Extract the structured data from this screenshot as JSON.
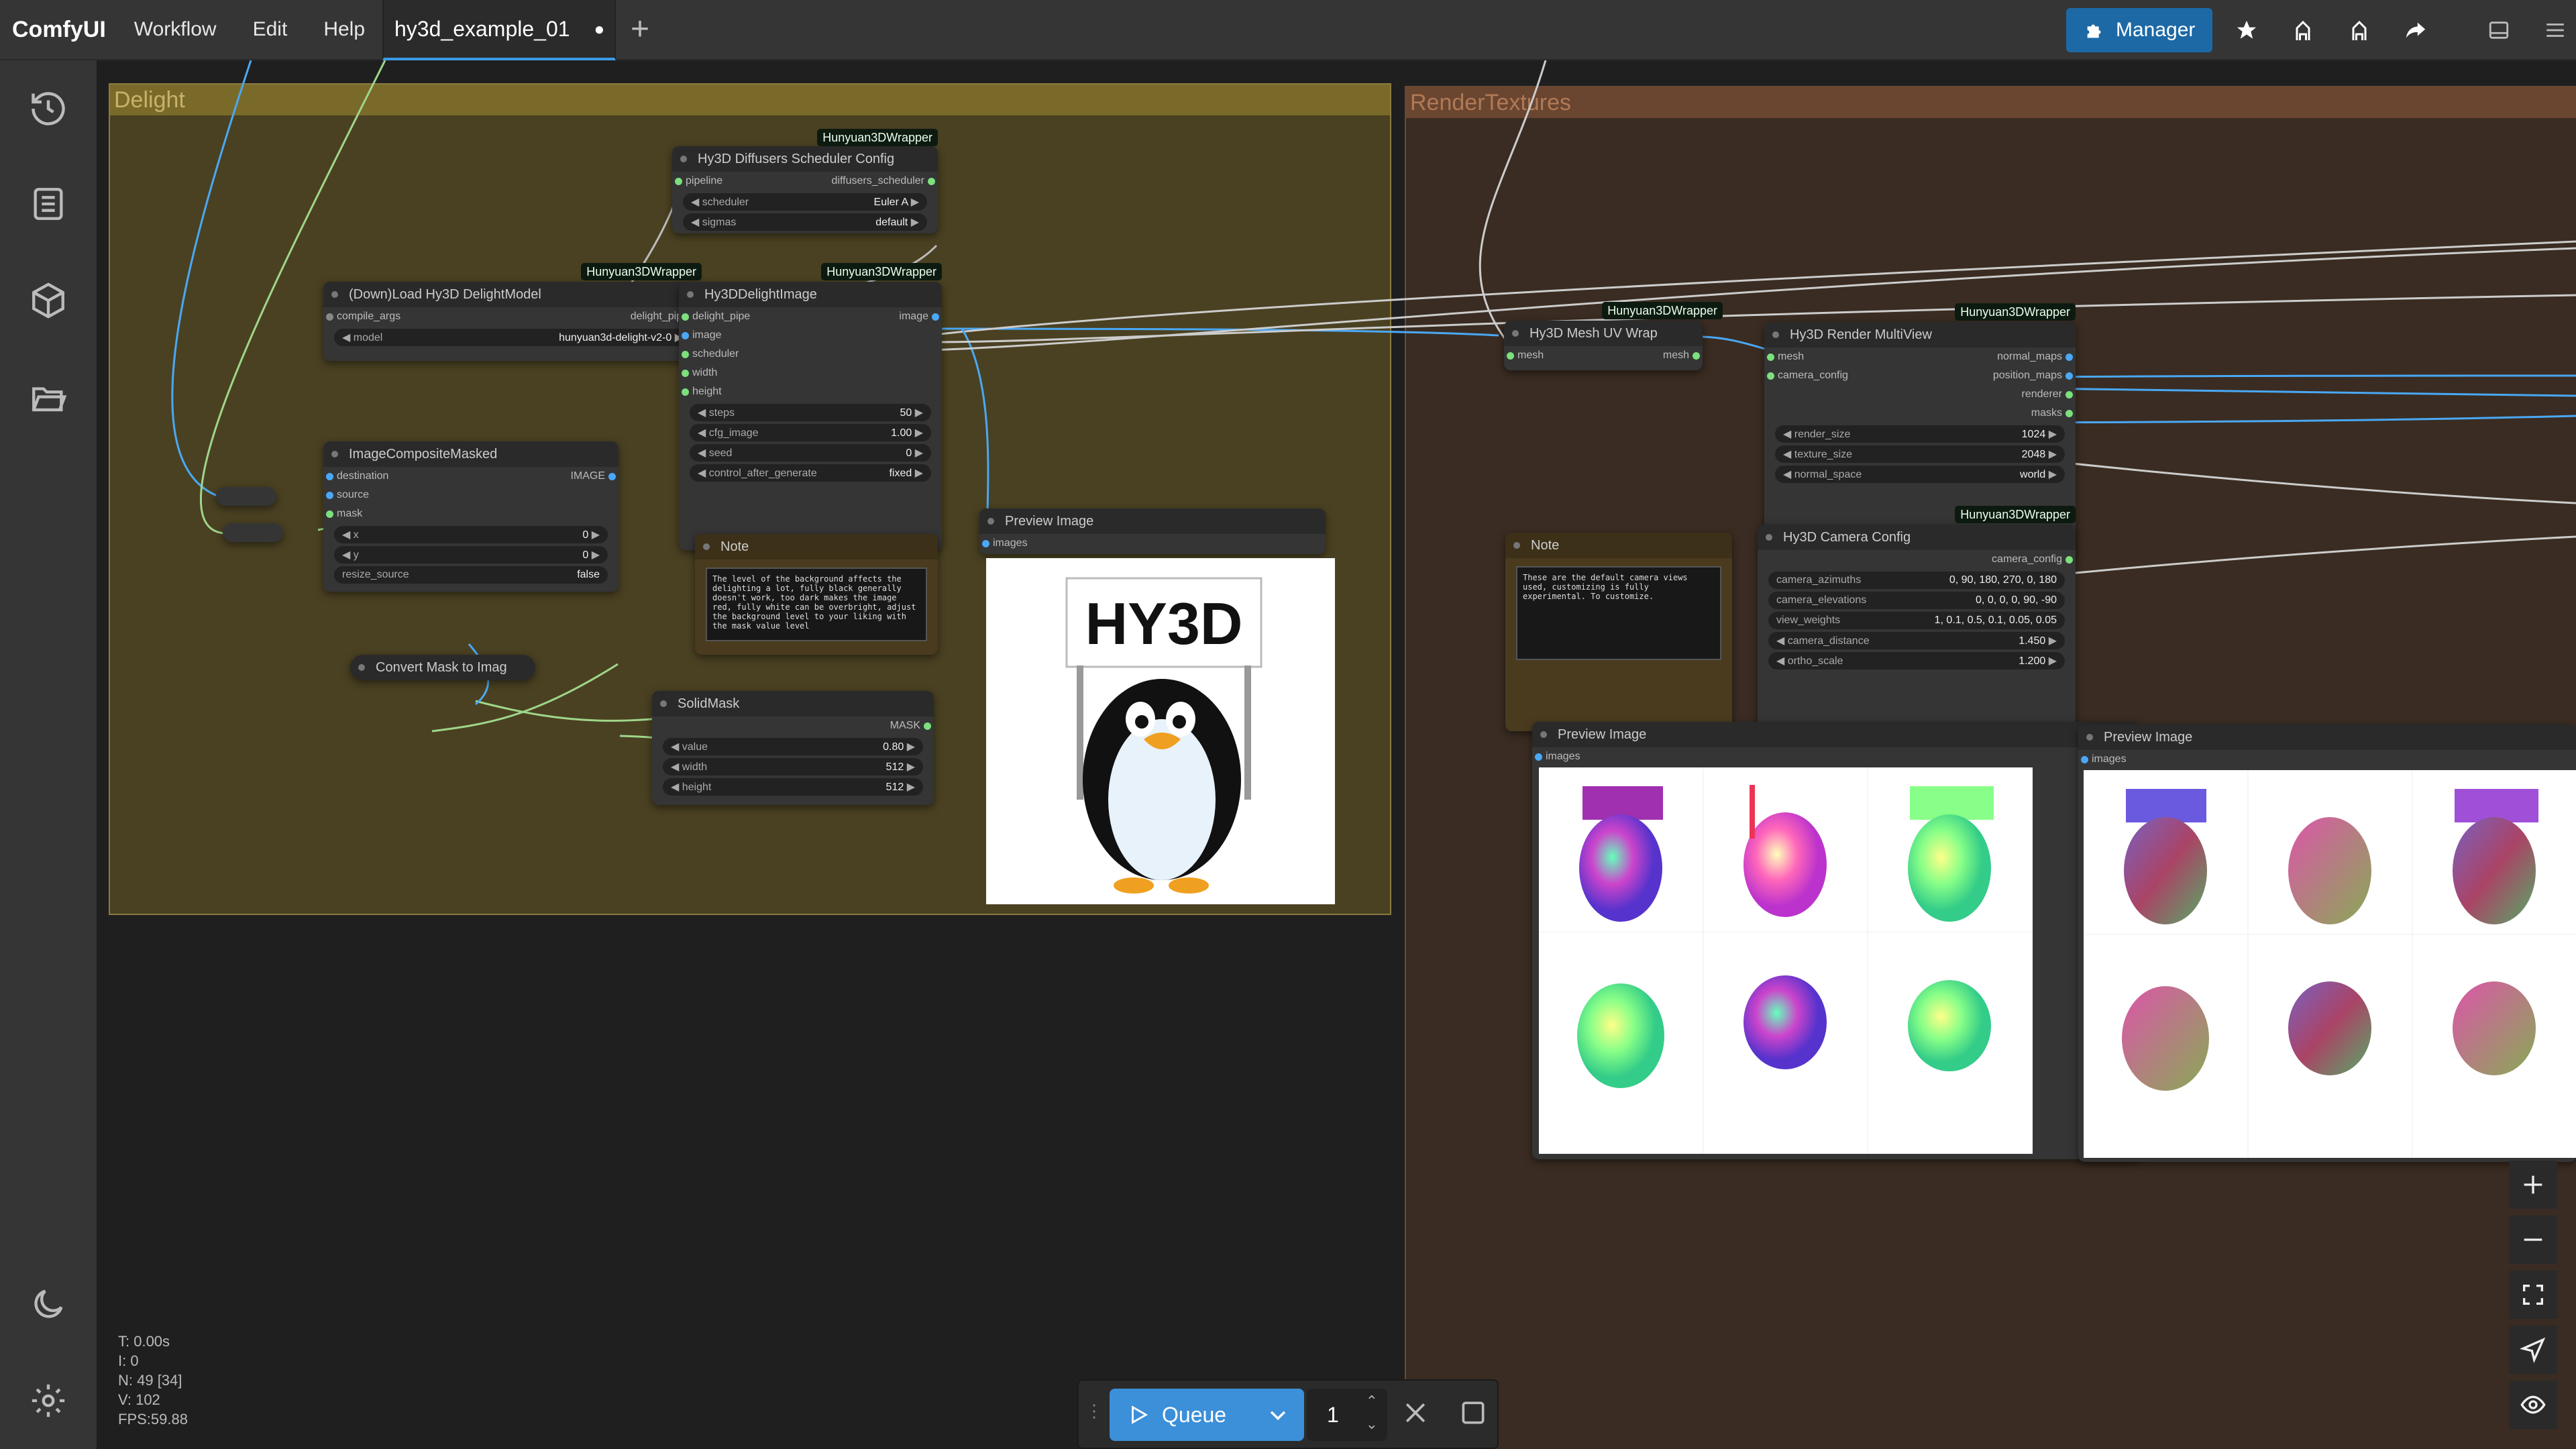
{
  "topbar": {
    "brand": "ComfyUI",
    "menu": [
      "Workflow",
      "Edit",
      "Help"
    ],
    "tab_title": "hy3d_example_01",
    "tab_modified": "●",
    "manager_label": "Manager"
  },
  "groups": {
    "delight": "Delight",
    "render": "RenderTextures"
  },
  "badge": "Hunyuan3DWrapper",
  "nodes": {
    "scheduler_config": {
      "title": "Hy3D Diffusers Scheduler Config",
      "input": "pipeline",
      "output": "diffusers_scheduler",
      "widgets": [
        {
          "label": "scheduler",
          "value": "Euler A"
        },
        {
          "label": "sigmas",
          "value": "default"
        }
      ]
    },
    "load_delight": {
      "title": "(Down)Load Hy3D DelightModel",
      "input": "compile_args",
      "output": "delight_pipe",
      "widgets": [
        {
          "label": "model",
          "value": "hunyuan3d-delight-v2-0"
        }
      ]
    },
    "delight_image": {
      "title": "Hy3DDelightImage",
      "inputs": [
        "delight_pipe",
        "image",
        "scheduler",
        "width",
        "height"
      ],
      "output": "image",
      "widgets": [
        {
          "label": "steps",
          "value": "50"
        },
        {
          "label": "cfg_image",
          "value": "1.00"
        },
        {
          "label": "seed",
          "value": "0"
        },
        {
          "label": "control_after_generate",
          "value": "fixed"
        }
      ]
    },
    "composite": {
      "title": "ImageCompositeMasked",
      "inputs": [
        "destination",
        "source",
        "mask"
      ],
      "output": "IMAGE",
      "widgets": [
        {
          "label": "x",
          "value": "0"
        },
        {
          "label": "y",
          "value": "0"
        },
        {
          "label": "resize_source",
          "value": "false"
        }
      ]
    },
    "note1": {
      "title": "Note",
      "text": "The level of the background affects the delighting a lot, fully black generally doesn't work, too dark makes the image red, fully white can be overbright, adjust the background level to your liking with the mask value level"
    },
    "convert_mask": {
      "title": "Convert Mask to Imag"
    },
    "solid_mask": {
      "title": "SolidMask",
      "output": "MASK",
      "widgets": [
        {
          "label": "value",
          "value": "0.80"
        },
        {
          "label": "width",
          "value": "512"
        },
        {
          "label": "height",
          "value": "512"
        }
      ]
    },
    "preview1": {
      "title": "Preview Image",
      "input": "images",
      "sign_text": "HY3D"
    },
    "mesh_uv": {
      "title": "Hy3D Mesh UV Wrap",
      "input": "mesh",
      "output": "mesh"
    },
    "render_multi": {
      "title": "Hy3D Render MultiView",
      "inputs": [
        "mesh",
        "camera_config"
      ],
      "outputs": [
        "normal_maps",
        "position_maps",
        "renderer",
        "masks"
      ],
      "widgets": [
        {
          "label": "render_size",
          "value": "1024"
        },
        {
          "label": "texture_size",
          "value": "2048"
        },
        {
          "label": "normal_space",
          "value": "world"
        }
      ]
    },
    "note2": {
      "title": "Note",
      "text": "These are the default camera views used, customizing is fully experimental. To customize."
    },
    "camera_config": {
      "title": "Hy3D Camera Config",
      "output": "camera_config",
      "widgets": [
        {
          "label": "camera_azimuths",
          "value": "0, 90, 180, 270, 0, 180"
        },
        {
          "label": "camera_elevations",
          "value": "0, 0, 0, 0, 90, -90"
        },
        {
          "label": "view_weights",
          "value": "1, 0.1, 0.5, 0.1, 0.05, 0.05"
        },
        {
          "label": "camera_distance",
          "value": "1.450"
        },
        {
          "label": "ortho_scale",
          "value": "1.200"
        }
      ]
    },
    "preview2": {
      "title": "Preview Image",
      "input": "images"
    },
    "preview3": {
      "title": "Preview Image",
      "input": "images"
    }
  },
  "stats": {
    "t": "T: 0.00s",
    "i": "I: 0",
    "n": "N: 49 [34]",
    "v": "V: 102",
    "fps": "FPS:59.88"
  },
  "queue": {
    "label": "Queue",
    "count": "1"
  },
  "icons": {
    "sidebar": [
      "history-icon",
      "queue-list-icon",
      "model-library-icon",
      "workflows-folder-icon",
      "theme-moon-icon",
      "settings-gear-icon"
    ]
  }
}
